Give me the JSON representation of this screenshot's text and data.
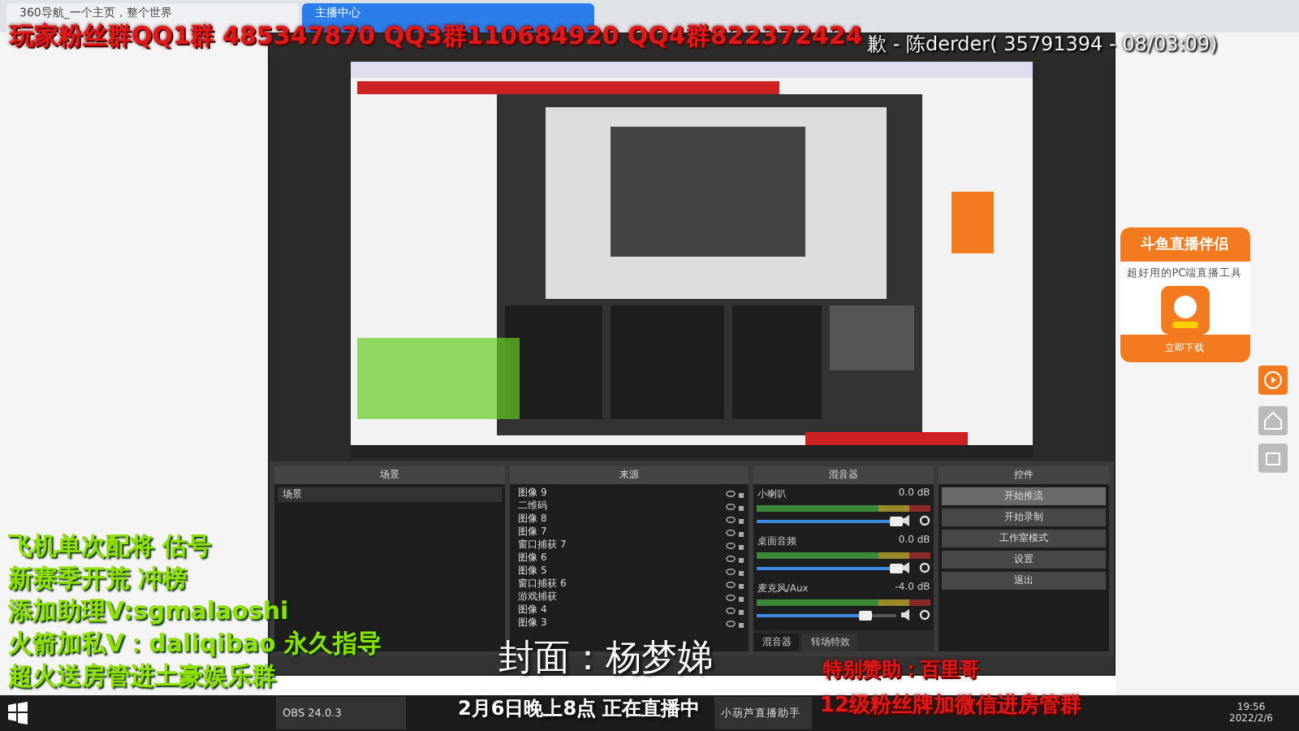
{
  "browser_tabs": [
    {
      "label": "360导航_一个主页，整个世界",
      "selected": false
    },
    {
      "label": "主播中心",
      "selected": true
    }
  ],
  "overlays": {
    "banner": "玩家粉丝群QQ1群 485347870 QQ3群110684920 QQ4群822372424",
    "ticker": "歉 - 陈derder( 35791394 - 08/03:09)",
    "promo_lines": [
      "飞机单次配将 估号",
      "新赛季开荒  冲榜",
      "添加助理V:sgmalaoshi",
      "火箭加私V：daliqibao 永久指导",
      "超火送房管进土豪娱乐群"
    ],
    "cover": "封面：杨梦娣",
    "schedule": "2月6日晚上8点   正在直播中",
    "sponsor": "特别赞助：百里哥",
    "fan_note": "12级粉丝牌加微信进房管群"
  },
  "obs": {
    "docks": [
      "场景",
      "来源",
      "混音器",
      "控件"
    ],
    "scenes": [
      {
        "label": "场景",
        "selected": true
      }
    ],
    "sources": [
      "图像 9",
      "二维码",
      "图像 8",
      "图像 7",
      "窗口捕获 7",
      "图像 6",
      "图像 5",
      "窗口捕获 6",
      "游戏捕获",
      "图像 4",
      "图像 3"
    ],
    "mixer": [
      {
        "name": "小喇叭",
        "reading": "0.0 dB",
        "level": 1
      },
      {
        "name": "桌面音频",
        "reading": "0.0 dB",
        "level": 1
      },
      {
        "name": "麦克风/Aux",
        "reading": "-4.0 dB",
        "level": 0.78
      }
    ],
    "mixer_tabs": [
      {
        "label": "混音器",
        "selected": true
      },
      {
        "label": "转场特效",
        "selected": false
      }
    ],
    "controls": [
      {
        "label": "开始推流",
        "selected": true
      },
      {
        "label": "开始录制",
        "selected": false
      },
      {
        "label": "工作室模式",
        "selected": false
      },
      {
        "label": "设置",
        "selected": false
      },
      {
        "label": "退出",
        "selected": false
      }
    ]
  },
  "ad": {
    "title": "斗鱼直播伴侣",
    "subtitle": "超好用的PC端直播工具",
    "button": "立即下载"
  },
  "taskbar": {
    "items": [
      "OBS 24.0.3",
      "小葫芦直播助手"
    ],
    "time": "19:56",
    "date": "2022/2/6"
  }
}
